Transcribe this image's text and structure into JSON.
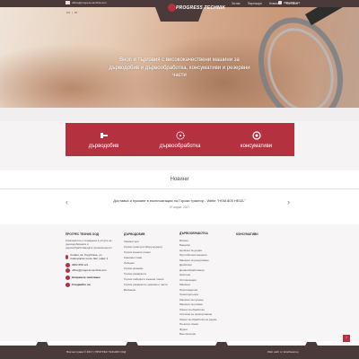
{
  "topbar": {
    "email": "office@progress-technik.com",
    "nav": [
      "За нас",
      "Партньори",
      "Новини",
      "Контакти"
    ],
    "phone": "0882 888 121"
  },
  "logo": {
    "text": "PROGRESS TECHNIK"
  },
  "lang": {
    "en": "EN",
    "sep": "|",
    "bg": "БГ"
  },
  "hero": {
    "text": "Внос и търговия с висококачествени машини за дърводобив и дървообработка, консумативи и резервни части"
  },
  "tiles": [
    {
      "label": "дърводобив",
      "icon": "chainsaw-icon"
    },
    {
      "label": "дървообработка",
      "icon": "saw-blade-icon"
    },
    {
      "label": "консумативи",
      "icon": "disc-icon"
    }
  ],
  "news": {
    "title": "Новини",
    "item": "Доставка и пускане в експлоатация на Горски трактор - Welte \"HSM 805 HEIZL\"",
    "date": "27 април, 2017",
    "prev": "‹",
    "next": "›"
  },
  "footer": {
    "col1": {
      "head": "ПРОГРЕС ТЕХНИК ООД",
      "desc": "Компанията е създадена в услуга на дърводобивната и дървообработващата промишленост",
      "address": "София, кв. Горубляне, ул. Самоковско шосе №2, офис 1",
      "phone": "0882 888 121",
      "email": "office@progress-technik.com",
      "contact_link": "Направете запитване",
      "follow_link": "Следвайте ни"
    },
    "col2": {
      "head": "ДЪРВОДОБИВ",
      "items": [
        "Харвестъри",
        "Горски трактори (Форуърдъри)",
        "Горски въжени линии",
        "Кранови глави",
        "Лебедки",
        "Горски кранове",
        "Горски ремаркета",
        "Горски лебедки и въжени линии",
        "Горски ремаркета, кранове и части",
        "Валмаши"
      ]
    },
    "col3": {
      "head": "ДЪРВООБРАБОТКА",
      "items": [
        "Бичкии",
        "Банцизи",
        "Цепачки за дърва",
        "Мултибичкии машини",
        "Машини за рендосване",
        "Дробилки",
        "Дървообработващи",
        "Циклони",
        "Оптимизация",
        "Машина",
        "Пресоизделия",
        "Транспортьори",
        "Машини за сушене",
        "Машини за рязане",
        "Линии за обработка",
        "Системи за прахоулавяне",
        "Линии за обработка на дърва",
        "Пелетни линии",
        "Фурни",
        "Вентилатори"
      ]
    },
    "col4": {
      "head": "КОНСУМАТИВИ"
    }
  },
  "bottombar": {
    "copyright": "Всички права © 2017 | ПРОГРЕС ТЕХНИК ООД",
    "developer": "Web сайт от Комбинатор"
  },
  "scrolltop": "↑"
}
